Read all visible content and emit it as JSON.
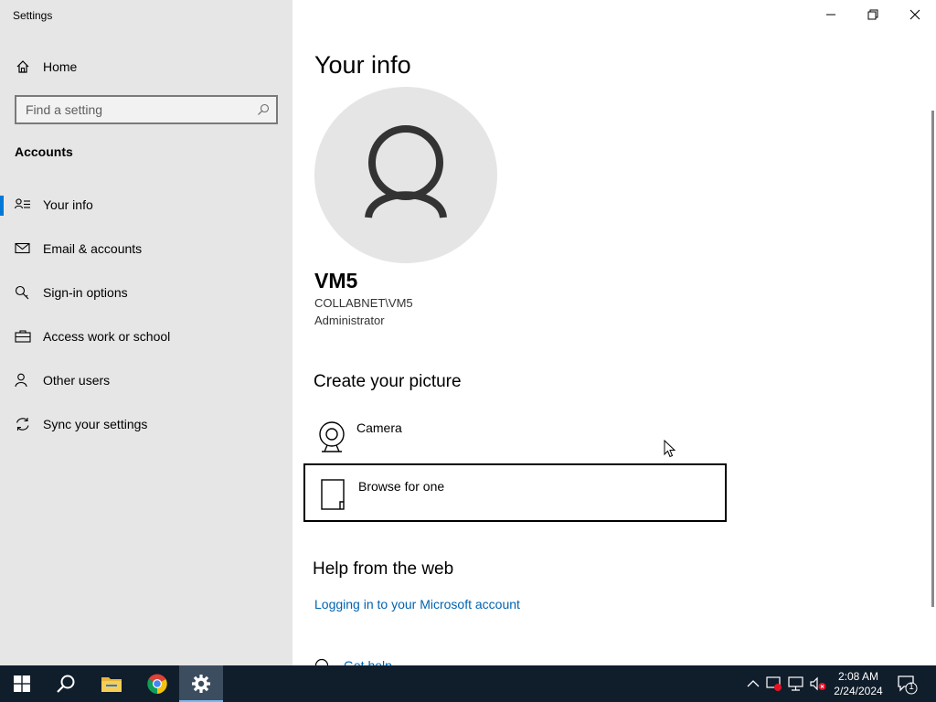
{
  "window": {
    "title": "Settings",
    "controls": [
      "minimize",
      "restore",
      "close"
    ]
  },
  "sidebar": {
    "home_label": "Home",
    "search_placeholder": "Find a setting",
    "section_title": "Accounts",
    "items": [
      {
        "label": "Your info",
        "icon": "person-list-icon",
        "selected": true
      },
      {
        "label": "Email & accounts",
        "icon": "mail-icon",
        "selected": false
      },
      {
        "label": "Sign-in options",
        "icon": "key-icon",
        "selected": false
      },
      {
        "label": "Access work or school",
        "icon": "briefcase-icon",
        "selected": false
      },
      {
        "label": "Other users",
        "icon": "person-icon",
        "selected": false
      },
      {
        "label": "Sync your settings",
        "icon": "sync-icon",
        "selected": false
      }
    ]
  },
  "main": {
    "page_title": "Your info",
    "user": {
      "name": "VM5",
      "domain": "COLLABNET\\VM5",
      "role": "Administrator"
    },
    "create_picture": {
      "heading": "Create your picture",
      "options": [
        {
          "label": "Camera",
          "icon": "camera-icon"
        },
        {
          "label": "Browse for one",
          "icon": "file-icon"
        }
      ]
    },
    "help": {
      "heading": "Help from the web",
      "links": [
        "Logging in to your Microsoft account",
        "Get help"
      ]
    }
  },
  "taskbar": {
    "apps": [
      "start-icon",
      "search-icon",
      "file-explorer-icon",
      "chrome-icon",
      "settings-icon"
    ],
    "time": "2:08 AM",
    "date": "2/24/2024",
    "notification_count": "1"
  },
  "colors": {
    "accent": "#0078d7",
    "link": "#0063b1",
    "sidebar_bg": "#e6e6e6",
    "taskbar_bg": "#101d2b"
  }
}
